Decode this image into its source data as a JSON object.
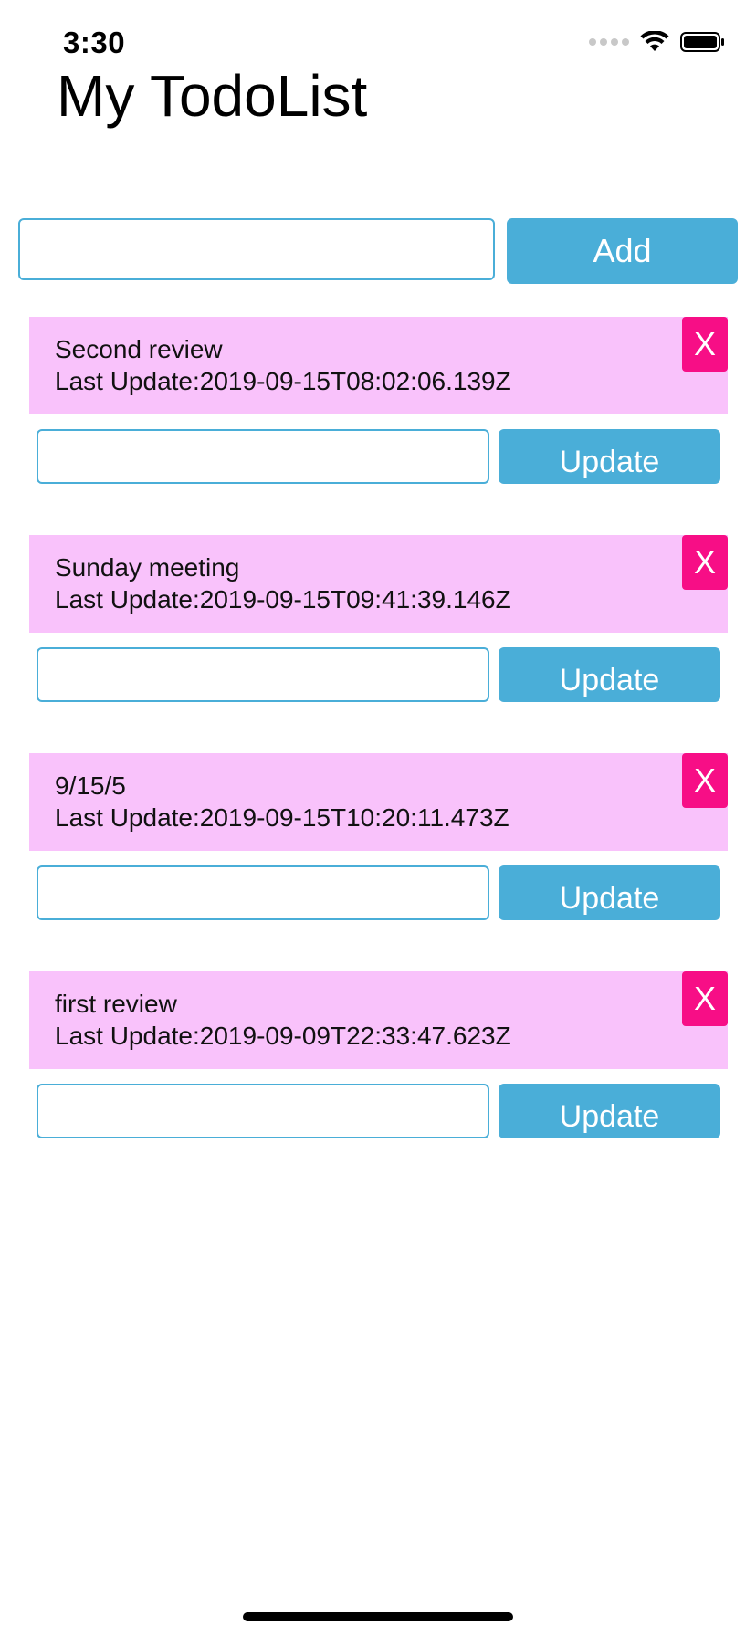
{
  "status_bar": {
    "time": "3:30",
    "icons": [
      "signal-icon",
      "wifi-icon",
      "battery-icon"
    ]
  },
  "header": {
    "title": "My TodoList"
  },
  "add_form": {
    "input_value": "",
    "button_label": "Add"
  },
  "todos": [
    {
      "title": "Second review",
      "updated_prefix": "Last Update:",
      "updated_at": "2019-09-15T08:02:06.139Z",
      "delete_label": "X",
      "update_input_value": "",
      "update_label": "Update"
    },
    {
      "title": "Sunday meeting",
      "updated_prefix": "Last Update:",
      "updated_at": "2019-09-15T09:41:39.146Z",
      "delete_label": "X",
      "update_input_value": "",
      "update_label": "Update"
    },
    {
      "title": "9/15/5",
      "updated_prefix": "Last Update:",
      "updated_at": "2019-09-15T10:20:11.473Z",
      "delete_label": "X",
      "update_input_value": "",
      "update_label": "Update"
    },
    {
      "title": "first review",
      "updated_prefix": "Last Update:",
      "updated_at": "2019-09-09T22:33:47.623Z",
      "delete_label": "X",
      "update_input_value": "",
      "update_label": "Update"
    }
  ],
  "colors": {
    "accent_blue": "#4aaed8",
    "card_pink": "#f9c2fb",
    "delete_pink": "#f70e86"
  }
}
